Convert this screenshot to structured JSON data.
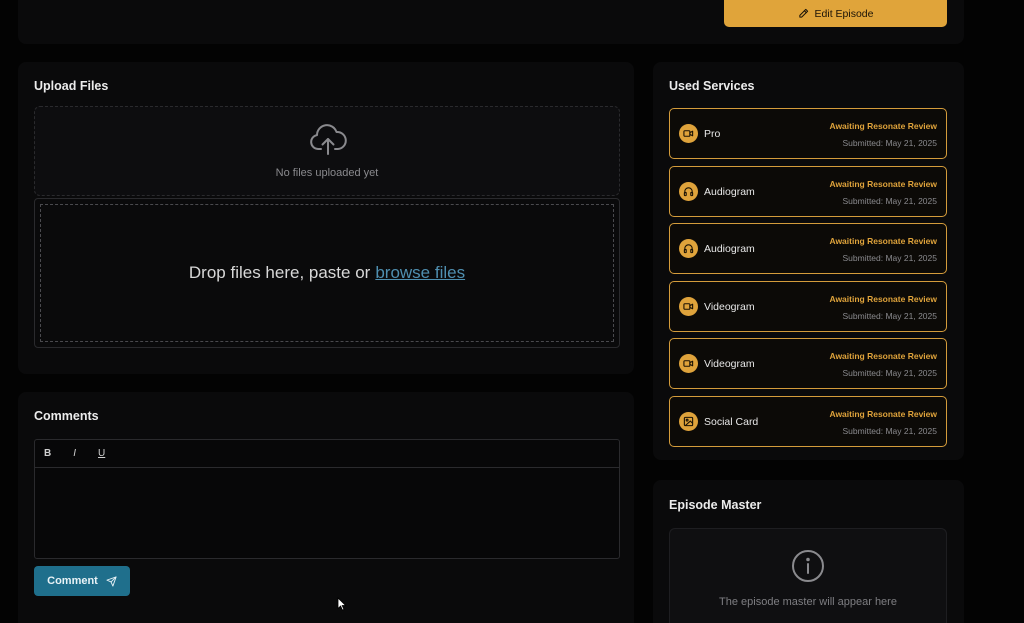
{
  "header": {
    "edit_episode_label": "Edit Episode"
  },
  "upload": {
    "title": "Upload Files",
    "empty_text": "No files uploaded yet",
    "drop_text": "Drop files here, paste or",
    "browse_label": "browse files"
  },
  "comments": {
    "title": "Comments",
    "toolbar": {
      "bold": "B",
      "italic": "I",
      "underline": "U"
    },
    "submit_label": "Comment"
  },
  "services": {
    "title": "Used Services",
    "items": [
      {
        "name": "Pro",
        "icon": "video-icon",
        "status": "Awaiting Resonate Review",
        "submitted": "Submitted: May 21, 2025"
      },
      {
        "name": "Audiogram",
        "icon": "headphones-icon",
        "status": "Awaiting Resonate Review",
        "submitted": "Submitted: May 21, 2025"
      },
      {
        "name": "Audiogram",
        "icon": "headphones-icon",
        "status": "Awaiting Resonate Review",
        "submitted": "Submitted: May 21, 2025"
      },
      {
        "name": "Videogram",
        "icon": "video-icon",
        "status": "Awaiting Resonate Review",
        "submitted": "Submitted: May 21, 2025"
      },
      {
        "name": "Videogram",
        "icon": "video-icon",
        "status": "Awaiting Resonate Review",
        "submitted": "Submitted: May 21, 2025"
      },
      {
        "name": "Social Card",
        "icon": "image-icon",
        "status": "Awaiting Resonate Review",
        "submitted": "Submitted: May 21, 2025"
      }
    ]
  },
  "master": {
    "title": "Episode Master",
    "empty_text": "The episode master will appear here"
  },
  "colors": {
    "accent": "#e0a43a",
    "primary_button": "#1f6f8c",
    "link": "#4f8fb0",
    "background": "#030303"
  }
}
